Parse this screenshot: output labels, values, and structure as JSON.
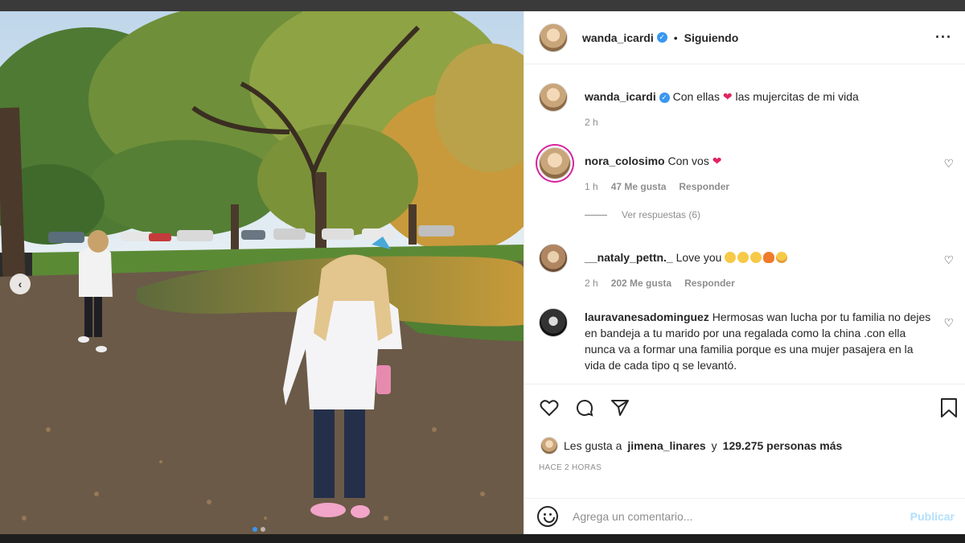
{
  "post": {
    "author": "wanda_icardi",
    "follow_status": "Siguiendo",
    "more_icon": "more-options-icon"
  },
  "caption": {
    "username": "wanda_icardi",
    "text_before": "Con ellas",
    "text_after": "las mujercitas de mi vida",
    "time": "2 h"
  },
  "comments": [
    {
      "username": "nora_colosimo",
      "text": "Con vos",
      "time": "1 h",
      "likes": "47 Me gusta",
      "reply": "Responder"
    },
    {
      "username": "__nataly_pettn._",
      "text": "Love you",
      "time": "2 h",
      "likes": "202 Me gusta",
      "reply": "Responder"
    },
    {
      "username": "lauravanesadominguez",
      "text": "Hermosas wan lucha por tu familia no dejes en bandeja a tu marido por una regalada como la china .con ella nunca va a formar una familia porque es una mujer pasajera en la vida de cada tipo q se levantó."
    }
  ],
  "view_replies": "Ver respuestas (6)",
  "likes": {
    "prefix": "Les gusta a",
    "user": "jimena_linares",
    "middle": "y",
    "count": "129.275 personas más"
  },
  "timestamp": "HACE 2 HORAS",
  "comment_box": {
    "placeholder": "Agrega un comentario...",
    "post_label": "Publicar"
  },
  "colors": {
    "accent": "#3897f0",
    "heart": "#e0245e",
    "publish_disabled": "#b2dffc"
  }
}
